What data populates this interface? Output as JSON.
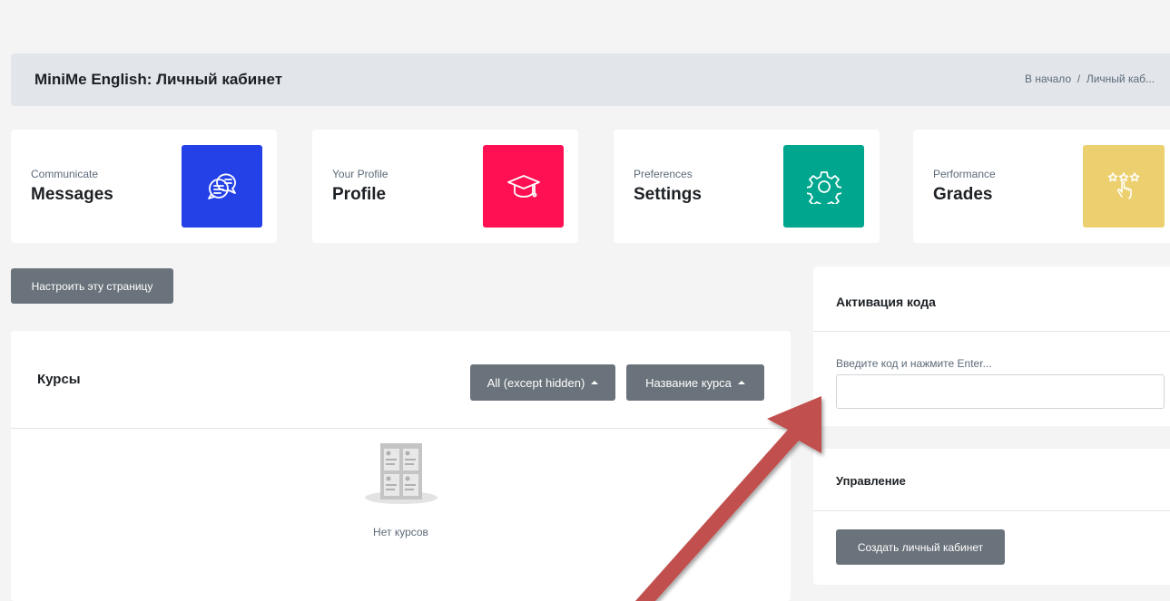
{
  "header": {
    "title": "MiniMe English: Личный кабинет",
    "breadcrumb": [
      "В начало",
      "Личный каб..."
    ],
    "breadcrumb_sep": "/"
  },
  "cards": [
    {
      "subtitle": "Communicate",
      "title": "Messages",
      "icon": "chat-bubbles-icon",
      "color": "#2441e7"
    },
    {
      "subtitle": "Your Profile",
      "title": "Profile",
      "icon": "graduation-cap-icon",
      "color": "#ff1053"
    },
    {
      "subtitle": "Preferences",
      "title": "Settings",
      "icon": "gear-icon",
      "color": "#00a78e"
    },
    {
      "subtitle": "Performance",
      "title": "Grades",
      "icon": "stars-hand-icon",
      "color": "#ecd06f"
    }
  ],
  "customize_button": "Настроить эту страницу",
  "courses": {
    "title": "Курсы",
    "filter_label": "All (except hidden)",
    "sort_label": "Название курса",
    "empty_text": "Нет курсов"
  },
  "activation": {
    "title": "Активация кода",
    "label": "Введите код и нажмите Enter...",
    "value": ""
  },
  "management": {
    "title": "Управление",
    "button": "Создать личный кабинет"
  },
  "colors": {
    "arrow": "#c0504d",
    "button": "#6a737b"
  }
}
